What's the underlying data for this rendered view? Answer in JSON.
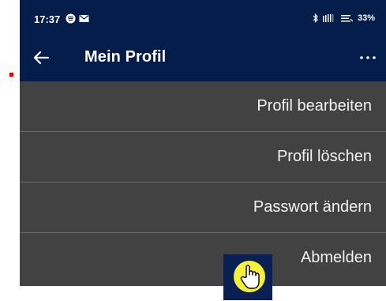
{
  "status_bar": {
    "time": "17:37",
    "battery": "33%",
    "icons": [
      "spotify-icon",
      "mail-icon",
      "bluetooth-icon",
      "vibrate-icon",
      "wifi-icon"
    ]
  },
  "app_bar": {
    "title": "Mein Profil",
    "back_icon": "arrow-left-icon",
    "more_icon": "more-horizontal-icon"
  },
  "menu": {
    "items": [
      {
        "label": "Profil bearbeiten"
      },
      {
        "label": "Profil löschen"
      },
      {
        "label": "Passwort ändern"
      },
      {
        "label": "Abmelden"
      }
    ]
  },
  "colors": {
    "app_bar": "#051d4a",
    "menu_background": "#424242",
    "divider": "#6a6a6a",
    "cursor_highlight": "#f6f03a",
    "marker": "#e00000"
  }
}
